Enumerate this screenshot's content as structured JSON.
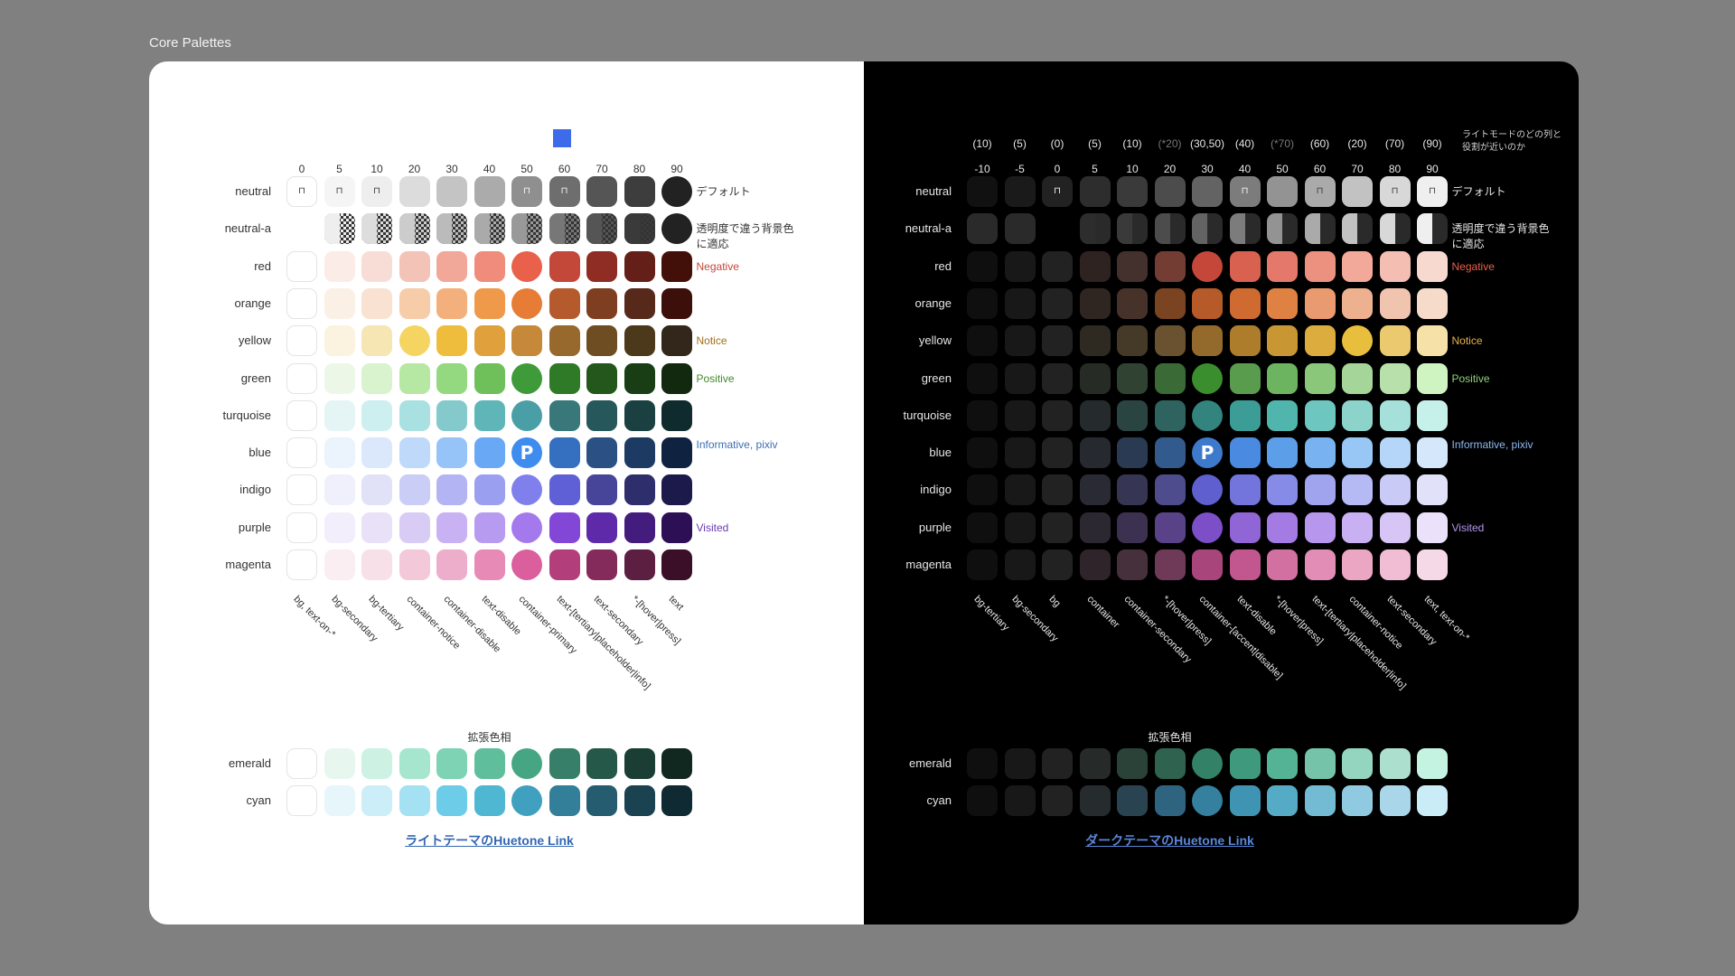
{
  "frame_title": "Core Palettes",
  "light": {
    "steps": [
      "0",
      "5",
      "10",
      "20",
      "30",
      "40",
      "50",
      "60",
      "70",
      "80",
      "90"
    ],
    "rows": [
      {
        "label": "neutral",
        "colors": [
          "#ffffff",
          "#f5f5f5",
          "#eeeeee",
          "#dcdcdc",
          "#c4c4c4",
          "#ababab",
          "#8f8f8f",
          "#6e6e6e",
          "#555555",
          "#3d3d3d",
          "#222222"
        ],
        "circle": [
          10
        ],
        "lock": [
          0,
          1,
          2,
          6,
          7
        ],
        "annot": "デフォルト",
        "annot_color": "#333333"
      },
      {
        "label": "neutral-a",
        "colors": [
          "#ffffff",
          "#eeeeee",
          "#dddddd",
          "#cccccc",
          "#bbbbbb",
          "#aaaaaa",
          "#999999",
          "#777777",
          "#555555",
          "#3a3a3a",
          "#222222"
        ],
        "circle": [
          10
        ],
        "checker": true,
        "annot": "透明度で違う背景色に適応",
        "annot_color": "#333333"
      },
      {
        "label": "red",
        "colors": [
          "#ffffff",
          "#fcece8",
          "#f8ddd6",
          "#f4c3b7",
          "#f1a898",
          "#ef8c7c",
          "#e9604b",
          "#c4483a",
          "#8f2c24",
          "#642018",
          "#431009"
        ],
        "circle": [
          6
        ],
        "annot": "Negative",
        "annot_color": "#c4483a"
      },
      {
        "label": "orange",
        "colors": [
          "#ffffff",
          "#fbf0e6",
          "#f9e2d1",
          "#f6cca9",
          "#f4b07c",
          "#ef9a4a",
          "#e67c35",
          "#b45a2c",
          "#7e3e20",
          "#56291a",
          "#3d0f0a"
        ],
        "circle": [
          6
        ],
        "annot": "",
        "annot_color": "#333333"
      },
      {
        "label": "yellow",
        "colors": [
          "#ffffff",
          "#fbf3df",
          "#f5e6b3",
          "#f5d462",
          "#efbd3e",
          "#e0a03b",
          "#c6893a",
          "#97692d",
          "#6d4d21",
          "#4c381b",
          "#33261a"
        ],
        "circle": [
          3
        ],
        "annot": "Notice",
        "annot_color": "#a06e1c"
      },
      {
        "label": "green",
        "colors": [
          "#ffffff",
          "#edf7e8",
          "#d8f3cd",
          "#b6e8a4",
          "#94d880",
          "#6fbf5a",
          "#3f9a39",
          "#2e7a26",
          "#24571c",
          "#193e15",
          "#12290f"
        ],
        "circle": [
          6
        ],
        "annot": "Positive",
        "annot_color": "#3f8a2a"
      },
      {
        "label": "turquoise",
        "colors": [
          "#ffffff",
          "#e5f5f6",
          "#cdeff0",
          "#a9e1e2",
          "#84cacd",
          "#5eb6b8",
          "#4a9ea5",
          "#38787b",
          "#26575a",
          "#1a4042",
          "#0f2b2d"
        ],
        "circle": [
          6
        ],
        "annot": "",
        "annot_color": "#333333"
      },
      {
        "label": "blue",
        "colors": [
          "#ffffff",
          "#ebf3fd",
          "#dbe8fc",
          "#bfd9fa",
          "#96c3f8",
          "#69a8f4",
          "#3d8cee",
          "#3570c0",
          "#2b5084",
          "#1d3a63",
          "#0f2340"
        ],
        "circle": [
          6
        ],
        "pixiv": 6,
        "annot": "Informative, pixiv",
        "annot_color": "#3d6eb5"
      },
      {
        "label": "indigo",
        "colors": [
          "#ffffff",
          "#eff0fb",
          "#e1e2f8",
          "#cacdf5",
          "#b2b4f3",
          "#9b9ff0",
          "#7f80ec",
          "#5f5fd6",
          "#46459a",
          "#2f2e6d",
          "#1c1a4a"
        ],
        "circle": [
          6
        ],
        "annot": "",
        "annot_color": "#333333"
      },
      {
        "label": "purple",
        "colors": [
          "#ffffff",
          "#f3eefb",
          "#e8e1f8",
          "#d8ccf5",
          "#c9b2f3",
          "#b79bf1",
          "#a479ed",
          "#8347d8",
          "#5f2aaa",
          "#431c7d",
          "#2c0f55"
        ],
        "circle": [
          6
        ],
        "annot": "Visited",
        "annot_color": "#6a3ab0"
      },
      {
        "label": "magenta",
        "colors": [
          "#ffffff",
          "#fbeef3",
          "#f7e0e8",
          "#f3c9da",
          "#ecaecb",
          "#e78bb6",
          "#db5e9d",
          "#b23f7b",
          "#852b5c",
          "#5c1e41",
          "#3a0f27"
        ],
        "circle": [
          6
        ],
        "annot": "",
        "annot_color": "#333333"
      }
    ],
    "col_labels": [
      "bg, text-on-*",
      "bg-secondary",
      "bg-tertiary",
      "container-notice",
      "container-disable",
      "text-disable",
      "container-primary",
      "text-[tertiary|placeholder|info]",
      "text-secondary",
      "*-[hover|press]",
      "text"
    ],
    "ext_title": "拡張色相",
    "ext_rows": [
      {
        "label": "emerald",
        "colors": [
          "#ffffff",
          "#e7f7f0",
          "#cdf2e3",
          "#a6e6ce",
          "#7dd3b3",
          "#5fbf9c",
          "#46a684",
          "#377f68",
          "#26584a",
          "#1b3e34",
          "#10281f"
        ],
        "circle": [
          6
        ]
      },
      {
        "label": "cyan",
        "colors": [
          "#ffffff",
          "#e6f6fb",
          "#cbeef8",
          "#a3e1f3",
          "#6dcde8",
          "#4fb7d2",
          "#3fa0bf",
          "#337f99",
          "#255c70",
          "#1a4250",
          "#0f2a33"
        ],
        "circle": [
          6
        ]
      }
    ],
    "link": "ライトテーマのHuetone Link"
  },
  "dark": {
    "paren_steps": [
      "(10)",
      "(5)",
      "(0)",
      "(5)",
      "(10)",
      "(*20)",
      "(30,50)",
      "(40)",
      "(*70)",
      "(60)",
      "(20)",
      "(70)",
      "(90)"
    ],
    "paren_dim": [
      5,
      8
    ],
    "steps": [
      "-10",
      "-5",
      "0",
      "5",
      "10",
      "20",
      "30",
      "40",
      "50",
      "60",
      "70",
      "80",
      "90"
    ],
    "note": "ライトモードのどの列と役割が近いのか",
    "rows": [
      {
        "label": "neutral",
        "colors": [
          "#111111",
          "#1a1a1a",
          "#222222",
          "#2d2d2d",
          "#3a3a3a",
          "#4c4c4c",
          "#636363",
          "#7c7c7c",
          "#939393",
          "#aaaaaa",
          "#c2c2c2",
          "#d8d8d8",
          "#efefef"
        ],
        "lock": [
          2,
          7,
          9,
          11,
          12
        ],
        "annot": "デフォルト",
        "annot_color": "#e6e6e6"
      },
      {
        "label": "neutral-a",
        "colors": [
          "#2a2a2a",
          "#2a2a2a",
          "#000000",
          "#2d2d2d",
          "#3a3a3a",
          "#4c4c4c",
          "#636363",
          "#7c7c7c",
          "#939393",
          "#aaaaaa",
          "#c2c2c2",
          "#d8d8d8",
          "#efefef"
        ],
        "annot": "透明度で違う背景色に適応",
        "annot_color": "#e6e6e6"
      },
      {
        "label": "red",
        "colors": [
          "#0f0f0f",
          "#181818",
          "#222222",
          "#2f2322",
          "#44302d",
          "#733d34",
          "#c4473a",
          "#d9614f",
          "#e4786a",
          "#ec907f",
          "#f2a999",
          "#f4bfb2",
          "#f7d9d0"
        ],
        "circle": [
          6
        ],
        "annot": "Negative",
        "annot_color": "#e9604b"
      },
      {
        "label": "orange",
        "colors": [
          "#0f0f0f",
          "#181818",
          "#222222",
          "#2f2622",
          "#47322a",
          "#7a4322",
          "#b65a2a",
          "#cf6b31",
          "#df8142",
          "#e99a6e",
          "#edb18f",
          "#f0c4ae",
          "#f6dbcb"
        ],
        "annot": "",
        "annot_color": "#e6e6e6"
      },
      {
        "label": "yellow",
        "colors": [
          "#0f0f0f",
          "#181818",
          "#222222",
          "#2e2921",
          "#443a27",
          "#6a5230",
          "#946a2c",
          "#ad7d2b",
          "#c99634",
          "#dcac3e",
          "#e8bf3c",
          "#eac96f",
          "#f6e1a8"
        ],
        "circle": [
          10
        ],
        "annot": "Notice",
        "annot_color": "#e6b24a"
      },
      {
        "label": "green",
        "colors": [
          "#0f0f0f",
          "#181818",
          "#222222",
          "#262c25",
          "#304332",
          "#3a6a36",
          "#3b8e2d",
          "#5a9c4d",
          "#6db461",
          "#8bc77b",
          "#a5d598",
          "#b8e0aa",
          "#cff4c2"
        ],
        "circle": [
          6
        ],
        "annot": "Positive",
        "annot_color": "#8ed37a"
      },
      {
        "label": "turquoise",
        "colors": [
          "#0f0f0f",
          "#181818",
          "#222222",
          "#252b2c",
          "#2a4442",
          "#2e6360",
          "#33837e",
          "#3c9c96",
          "#4fb5ad",
          "#6dc6bf",
          "#8cd3cc",
          "#a6e0da",
          "#c6f0ea"
        ],
        "circle": [
          6
        ],
        "annot": "",
        "annot_color": "#e6e6e6"
      },
      {
        "label": "blue",
        "colors": [
          "#0f0f0f",
          "#181818",
          "#222222",
          "#262a30",
          "#2a3a52",
          "#335a8c",
          "#3d7acc",
          "#4a8ae0",
          "#5c9ee8",
          "#78b2f0",
          "#98c6f5",
          "#b5d6f8",
          "#d5e7fb"
        ],
        "circle": [
          6
        ],
        "pixiv": 6,
        "annot": "Informative, pixiv",
        "annot_color": "#8cb9f2"
      },
      {
        "label": "indigo",
        "colors": [
          "#0f0f0f",
          "#181818",
          "#222222",
          "#292a33",
          "#363654",
          "#4e4c8c",
          "#5f5fcf",
          "#7375dc",
          "#878be8",
          "#a0a4ef",
          "#b5b9f4",
          "#c9cbf6",
          "#e1e2fa"
        ],
        "circle": [
          6
        ],
        "annot": "",
        "annot_color": "#e6e6e6"
      },
      {
        "label": "purple",
        "colors": [
          "#0f0f0f",
          "#181818",
          "#222222",
          "#2b2832",
          "#3c3150",
          "#5a4288",
          "#7c4fc9",
          "#9065d6",
          "#a47ae3",
          "#b797ee",
          "#c8b0f2",
          "#d6c5f5",
          "#ebe1fb"
        ],
        "circle": [
          6
        ],
        "annot": "Visited",
        "annot_color": "#b596f0"
      },
      {
        "label": "magenta",
        "colors": [
          "#0f0f0f",
          "#181818",
          "#222222",
          "#2e242a",
          "#46303c",
          "#6f3a57",
          "#a8467c",
          "#c2578f",
          "#d270a1",
          "#e28db5",
          "#eba6c4",
          "#f0bdd4",
          "#f6d9e6"
        ],
        "annot": "",
        "annot_color": "#e6e6e6"
      }
    ],
    "col_labels": [
      "bg-tertiary",
      "bg-secondary",
      "bg",
      "container",
      "container-secondary",
      "*-[hover|press]",
      "container-[accent|disable]",
      "text-disable",
      "*-[hover|press]",
      "text-[tertiary|placeholder|info]",
      "container-notice",
      "text-secondary",
      "text, text-on-*"
    ],
    "col_dim": [
      5,
      8
    ],
    "ext_title": "拡張色相",
    "ext_rows": [
      {
        "label": "emerald",
        "colors": [
          "#0f0f0f",
          "#181818",
          "#222222",
          "#262b29",
          "#2a4238",
          "#2f634f",
          "#338267",
          "#3f9a7d",
          "#54b394",
          "#75c4a9",
          "#94d5bf",
          "#acdfce",
          "#c4f3e2"
        ],
        "circle": [
          6
        ]
      },
      {
        "label": "cyan",
        "colors": [
          "#0f0f0f",
          "#181818",
          "#222222",
          "#262b2e",
          "#2a4350",
          "#2e6480",
          "#34809e",
          "#3e94b2",
          "#55aac6",
          "#73bbd2",
          "#8fcae0",
          "#a9d6e8",
          "#c9ecf7"
        ],
        "circle": [
          6
        ]
      }
    ],
    "link": "ダークテーマのHuetone Link"
  },
  "colors": {
    "accent_square": "#3d6bea",
    "card_bg_light": "#ffffff",
    "card_bg_dark": "#000000",
    "page_bg": "#808080"
  }
}
